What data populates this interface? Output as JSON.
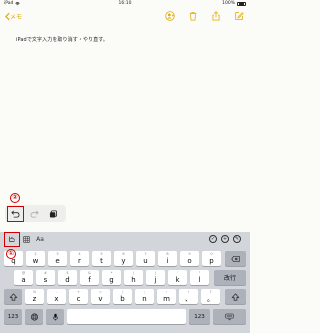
{
  "status": {
    "device": "iPad",
    "time": "16:10",
    "battery": "100%"
  },
  "navbar": {
    "back_label": "メモ"
  },
  "note": {
    "body": "iPadで文字入力を取り消す・やり直す。"
  },
  "annotations": {
    "marker_1": "①",
    "marker_2": "②"
  },
  "toolbar": {
    "format_label": "Aa"
  },
  "keyboard": {
    "row1": [
      {
        "hint": "1",
        "label": "q"
      },
      {
        "hint": "2",
        "label": "w"
      },
      {
        "hint": "3",
        "label": "e"
      },
      {
        "hint": "4",
        "label": "r"
      },
      {
        "hint": "5",
        "label": "t"
      },
      {
        "hint": "6",
        "label": "y"
      },
      {
        "hint": "7",
        "label": "u"
      },
      {
        "hint": "8",
        "label": "i"
      },
      {
        "hint": "9",
        "label": "o"
      },
      {
        "hint": "0",
        "label": "p"
      }
    ],
    "row2": [
      {
        "hint": "@",
        "label": "a"
      },
      {
        "hint": "#",
        "label": "s"
      },
      {
        "hint": "$",
        "label": "d"
      },
      {
        "hint": "&",
        "label": "f"
      },
      {
        "hint": "*",
        "label": "g"
      },
      {
        "hint": "(",
        "label": "h"
      },
      {
        "hint": ")",
        "label": "j"
      },
      {
        "hint": "'",
        "label": "k"
      },
      {
        "hint": "\"",
        "label": "l"
      }
    ],
    "row3": [
      {
        "hint": "%",
        "label": "z"
      },
      {
        "hint": "-",
        "label": "x"
      },
      {
        "hint": "+",
        "label": "c"
      },
      {
        "hint": "=",
        "label": "v"
      },
      {
        "hint": "/",
        "label": "b"
      },
      {
        "hint": ";",
        "label": "n"
      },
      {
        "hint": ":",
        "label": "m"
      },
      {
        "hint": "!",
        "label": "、"
      },
      {
        "hint": "?",
        "label": "。"
      }
    ],
    "return_label": "改行",
    "numbers_label": "123",
    "numbers_label_right": "123"
  }
}
